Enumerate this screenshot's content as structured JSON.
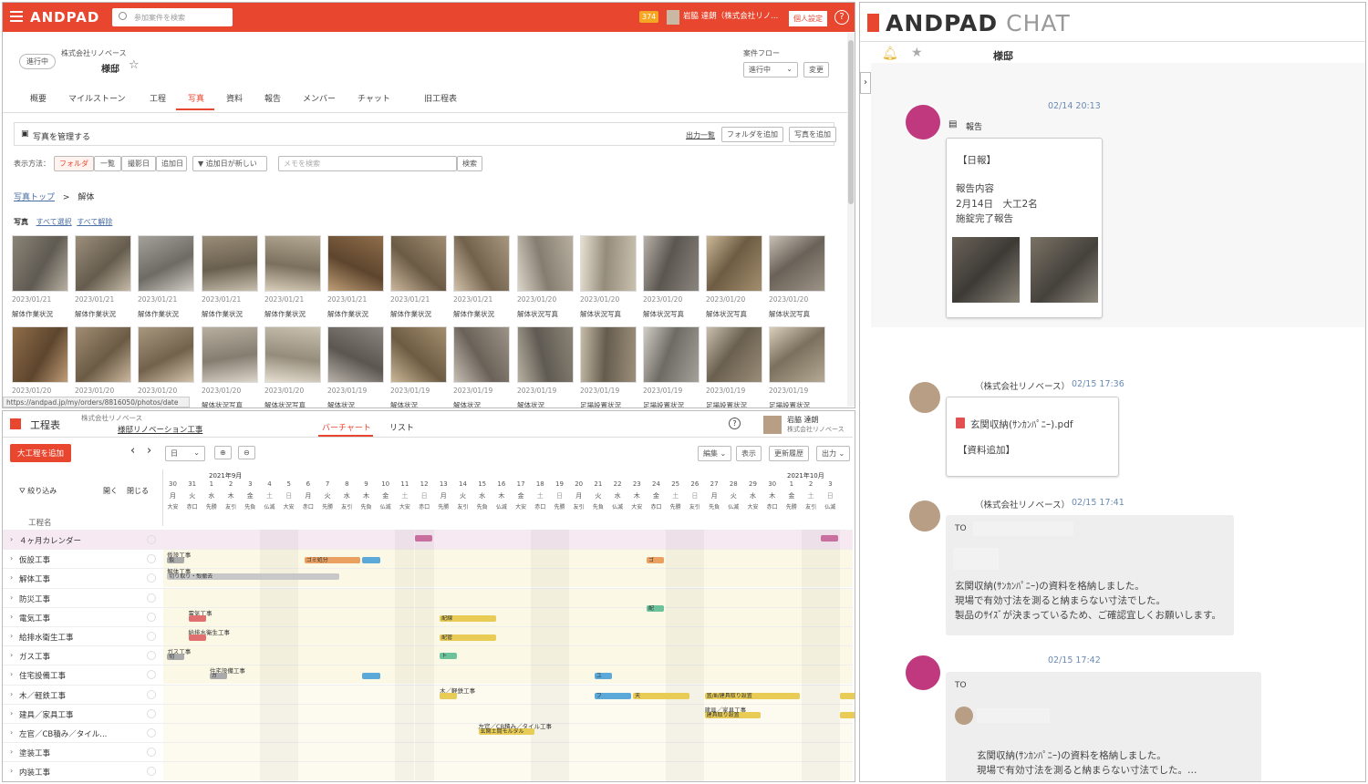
{
  "topbar": {
    "brand": "ANDPAD",
    "search_placeholder": "参加案件を検索",
    "notification_count": "374",
    "user_name": "岩脇 達朗（株式会社リノ...",
    "settings_label": "個人設定",
    "help_glyph": "?"
  },
  "project": {
    "status": "進行中",
    "company": "株式会社リノベース",
    "name": "様邸",
    "flow_label": "案件フロー",
    "flow_value": "進行中",
    "change_label": "変更"
  },
  "tabs": [
    "概要",
    "マイルストーン",
    "工程",
    "写真",
    "資料",
    "報告",
    "メンバー",
    "チャット",
    "旧工程表"
  ],
  "photos": {
    "manage_title": "写真を管理する",
    "output_list": "出力一覧",
    "add_folder": "フォルダを追加",
    "add_photo": "写真を追加",
    "display_label": "表示方法：",
    "view_modes": [
      "フォルダ",
      "一覧",
      "撮影日",
      "追加日"
    ],
    "sort_label": "▼ 追加日が新しい",
    "memo_placeholder": "メモを検索",
    "search_btn": "検索",
    "breadcrumb_root": "写真トップ",
    "breadcrumb_sep": ">",
    "breadcrumb_current": "解体",
    "section_label": "写真",
    "select_all": "すべて選択",
    "deselect_all": "すべて解除",
    "status_url": "https://andpad.jp/my/orders/8816050/photos/date",
    "row1": [
      {
        "date": "2023/01/21",
        "label": "解体作業状況"
      },
      {
        "date": "2023/01/21",
        "label": "解体作業状況"
      },
      {
        "date": "2023/01/21",
        "label": "解体作業状況"
      },
      {
        "date": "2023/01/21",
        "label": "解体作業状況"
      },
      {
        "date": "2023/01/21",
        "label": "解体作業状況"
      },
      {
        "date": "2023/01/21",
        "label": "解体作業状況"
      },
      {
        "date": "2023/01/21",
        "label": "解体作業状況"
      },
      {
        "date": "2023/01/21",
        "label": "解体作業状況"
      },
      {
        "date": "2023/01/20",
        "label": "解体状況写真"
      },
      {
        "date": "2023/01/20",
        "label": "解体状況写真"
      },
      {
        "date": "2023/01/20",
        "label": "解体状況写真"
      },
      {
        "date": "2023/01/20",
        "label": "解体状況写真"
      },
      {
        "date": "2023/01/20",
        "label": "解体状況写真"
      }
    ],
    "row2": [
      {
        "date": "2023/01/20",
        "label": "解体状況写真"
      },
      {
        "date": "2023/01/20",
        "label": "解体状況写真"
      },
      {
        "date": "2023/01/20",
        "label": "解体状況写真"
      },
      {
        "date": "2023/01/20",
        "label": "解体状況写真"
      },
      {
        "date": "2023/01/20",
        "label": "解体状況写真"
      },
      {
        "date": "2023/01/19",
        "label": "解体状況"
      },
      {
        "date": "2023/01/19",
        "label": "解体状況"
      },
      {
        "date": "2023/01/19",
        "label": "解体状況"
      },
      {
        "date": "2023/01/19",
        "label": "解体状況"
      },
      {
        "date": "2023/01/19",
        "label": "足場設置状況"
      },
      {
        "date": "2023/01/19",
        "label": "足場設置状況"
      },
      {
        "date": "2023/01/19",
        "label": "足場設置状況"
      },
      {
        "date": "2023/01/19",
        "label": "足場設置状況"
      }
    ]
  },
  "schedule": {
    "title": "工程表",
    "company": "株式会社リノベース",
    "project_link": "様邸リノベーション工事",
    "tab_bar": "バーチャート",
    "tab_list": "リスト",
    "user_name": "岩脇 達朗",
    "user_company": "株式会社リノベース",
    "add_btn": "大工程を追加",
    "unit_select": "日",
    "edit_btn": "編集",
    "view_btn": "表示",
    "history_btn": "更新履歴",
    "output_btn": "出力",
    "filter_label": "絞り込み",
    "open_label": "開く",
    "close_label": "閉じる",
    "name_header": "工程名",
    "month1": "2021年9月",
    "month2": "2021年10月",
    "days": [
      "30",
      "31",
      "1",
      "2",
      "3",
      "4",
      "5",
      "6",
      "7",
      "8",
      "9",
      "10",
      "11",
      "12",
      "13",
      "14",
      "15",
      "16",
      "17",
      "18",
      "19",
      "20",
      "21",
      "22",
      "23",
      "24",
      "25",
      "26",
      "27",
      "28",
      "29",
      "30",
      "1",
      "2",
      "3"
    ],
    "weekdays": [
      "月",
      "火",
      "水",
      "木",
      "金",
      "土",
      "日",
      "月",
      "火",
      "水",
      "木",
      "金",
      "土",
      "日",
      "月",
      "火",
      "水",
      "木",
      "金",
      "土",
      "日",
      "月",
      "火",
      "水",
      "木",
      "金",
      "土",
      "日",
      "月",
      "火",
      "水",
      "木",
      "金",
      "土",
      "日"
    ],
    "rokuyo": [
      "大安",
      "赤口",
      "先勝",
      "友引",
      "先負",
      "仏滅",
      "大安",
      "赤口",
      "先勝",
      "友引",
      "先負",
      "仏滅",
      "大安",
      "赤口",
      "先勝",
      "友引",
      "先負",
      "仏滅",
      "大安",
      "赤口",
      "先勝",
      "友引",
      "先負",
      "仏滅",
      "大安",
      "赤口",
      "先勝",
      "友引",
      "先負",
      "仏滅",
      "大安",
      "赤口",
      "先勝",
      "友引",
      "仏滅"
    ],
    "rows": [
      "４ヶ月カレンダー",
      "仮設工事",
      "解体工事",
      "防災工事",
      "電気工事",
      "給排水衛生工事",
      "ガス工事",
      "住宅設備工事",
      "木／軽鉄工事",
      "建具／家具工事",
      "左官／CB積み／タイル...",
      "塗装工事",
      "内装工事"
    ],
    "bar_labels": {
      "kasetsu": "仮設工事",
      "kaitai": "解体工事",
      "kaitai_sub": "切り取り・殻撤去",
      "gomi": "ゴミ処分",
      "denki": "電気工事",
      "kyuhai": "給排水衛生工事",
      "gas": "ガス工事",
      "jusetsu": "住宅設備工事",
      "moku": "木／軽鉄工事",
      "tategu": "建具／家具工事",
      "tategu_sub": "建具／家具工事",
      "sakan": "左官／CB積み／タイル工事",
      "sakan_sub": "玄関土間モルタル",
      "chips": [
        "仮",
        "ゴ",
        "配",
        "配線",
        "配管",
        "ト",
        "切",
        "ガ",
        "床",
        "天",
        "設",
        "ユ",
        "テ",
        "鏡",
        "フ",
        "建",
        "置"
      ],
      "yuka_set": "置/Ⅲ/建具取り設置",
      "tategu_set": "建具取り設置"
    }
  },
  "chat": {
    "brand": "ANDPAD",
    "brand_suffix": "CHAT",
    "room_name": "様邸",
    "msg1_time": "02/14 20:13",
    "msg1_type": "報告",
    "msg1_title": "【日報】",
    "msg1_line1": "報告内容",
    "msg1_line2": "2月14日　大工2名",
    "msg1_line3": "施錠完了報告",
    "msg2_sender": "（株式会社リノベース）",
    "msg2_time": "02/15 17:36",
    "msg2_file": "玄関収納(ｻﾝｶﾝﾊﾟﾆｰ).pdf",
    "msg2_tag": "【資料追加】",
    "msg3_sender": "（株式会社リノベース）",
    "msg3_time": "02/15 17:41",
    "msg3_to": "TO",
    "msg3_line1": "玄関収納(ｻﾝｶﾝﾊﾟﾆｰ)の資料を格納しました。",
    "msg3_line2": "現場で有効寸法を測ると納まらない寸法でした。",
    "msg3_line3": "製品のｻｲｽﾞが決まっているため、ご確認宜しくお願いします。",
    "msg4_time": "02/15 17:42",
    "msg4_to": "TO",
    "msg4_line1": "玄関収納(ｻﾝｶﾝﾊﾟﾆｰ)の資料を格納しました。",
    "msg4_line2": "現場で有効寸法を測ると納まらない寸法でした。…"
  }
}
